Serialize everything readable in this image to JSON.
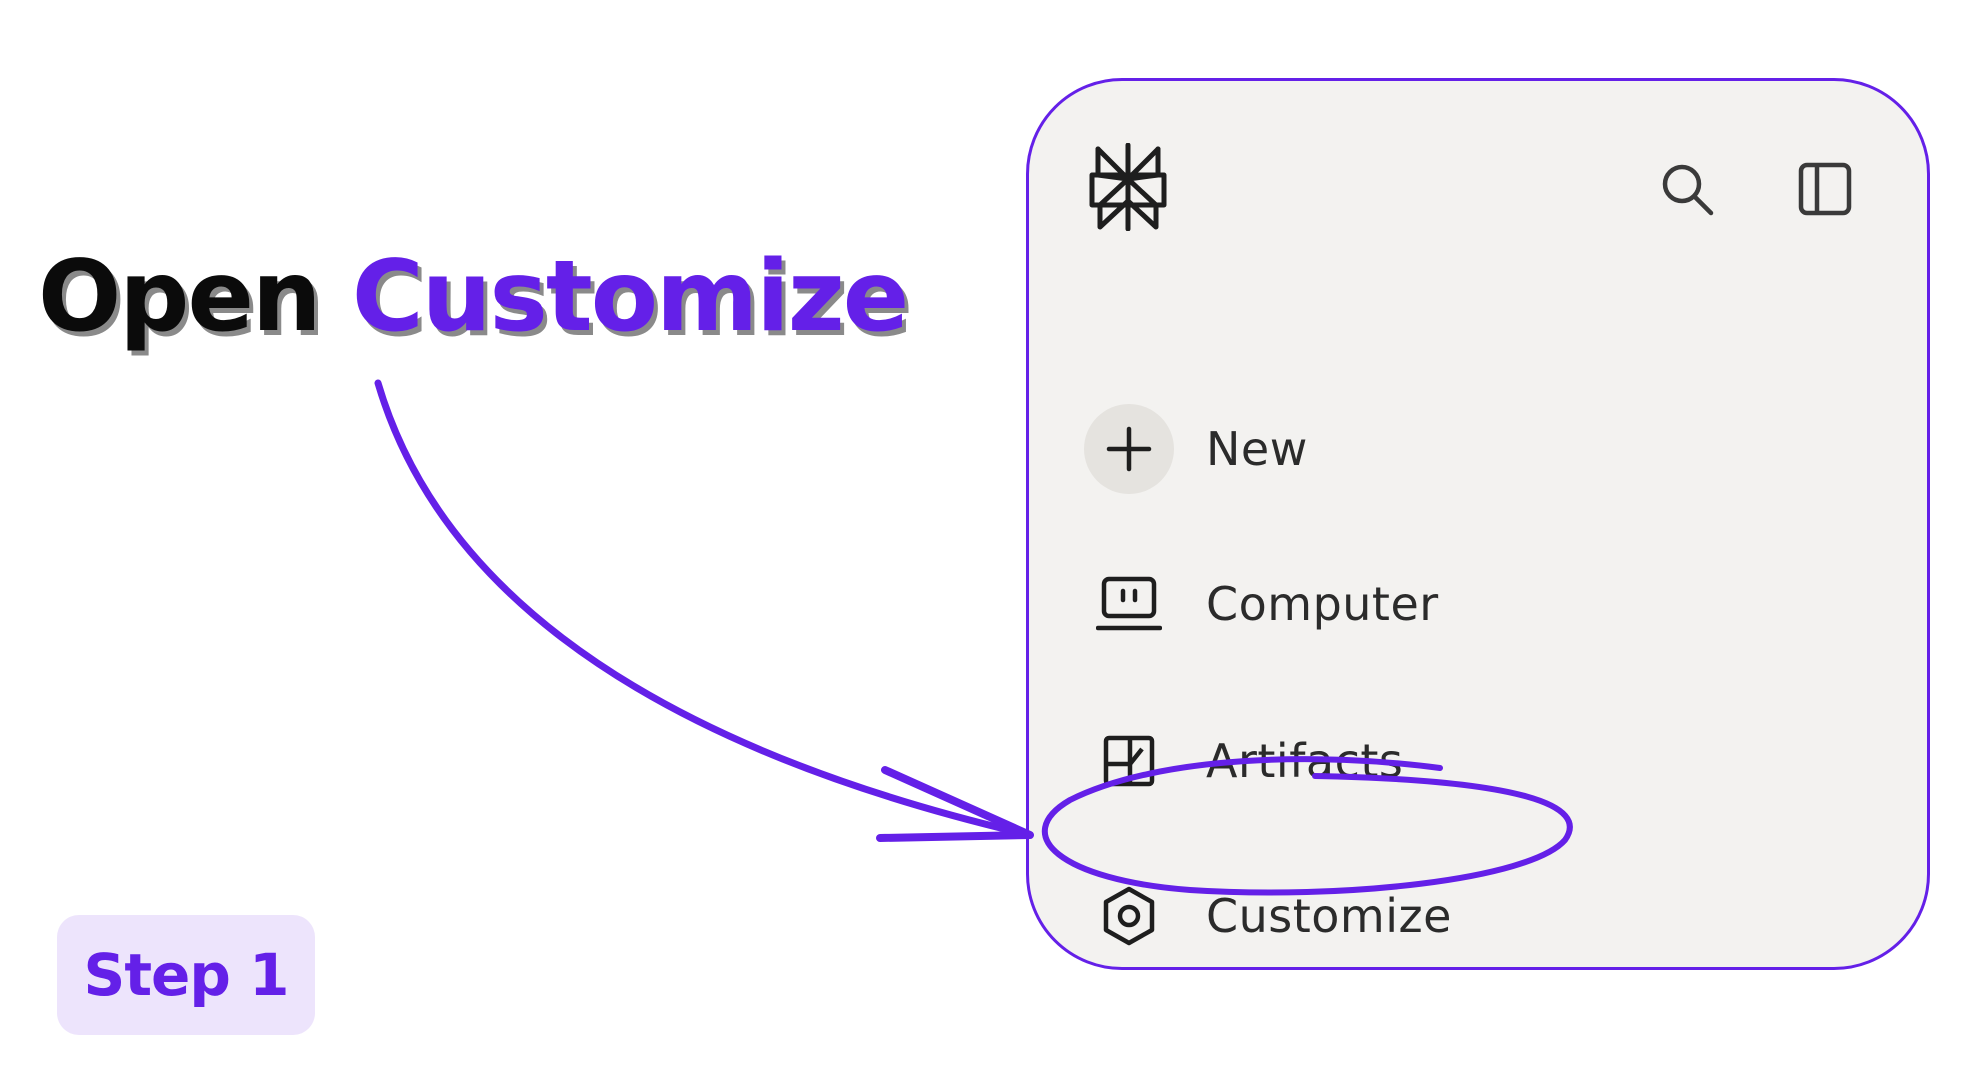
{
  "headline": {
    "word1": "Open",
    "word2": "Customize"
  },
  "step_badge": "Step 1",
  "sidebar": {
    "logo_icon": "perplexity-logo-icon",
    "top_icons": [
      "search-icon",
      "sidebar-toggle-icon"
    ],
    "items": [
      {
        "label": "New",
        "icon": "plus-icon"
      },
      {
        "label": "Computer",
        "icon": "computer-icon"
      },
      {
        "label": "Artifacts",
        "icon": "artifacts-icon"
      },
      {
        "label": "Customize",
        "icon": "hexagon-settings-icon"
      }
    ]
  },
  "colors": {
    "accent": "#6420e8",
    "badge_background": "#ede4fc",
    "panel_background": "#f3f2f0",
    "text_dark": "#0b0b0b"
  }
}
